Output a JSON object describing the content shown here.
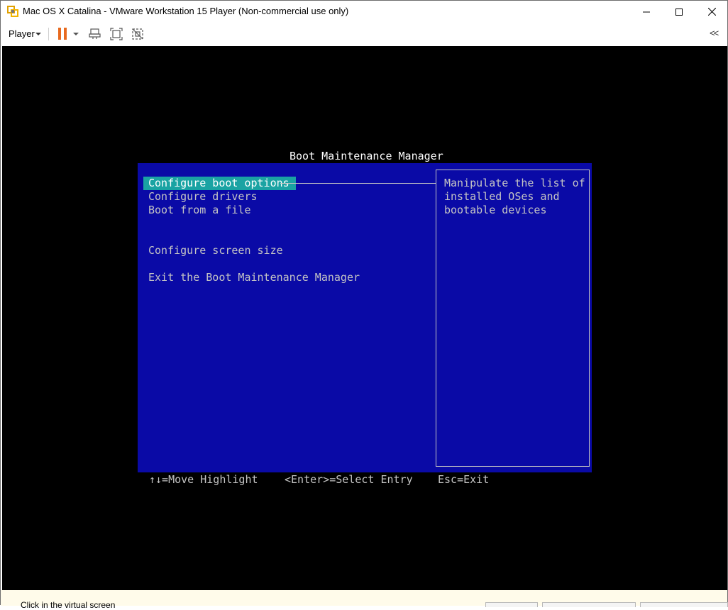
{
  "window": {
    "title": "Mac OS X Catalina - VMware Workstation 15 Player (Non-commercial use only)",
    "minimize_glyph": "—",
    "maximize_glyph": "☐",
    "close_glyph": "✕"
  },
  "toolbar": {
    "player_menu_label": "Player",
    "icons": [
      "pause-icon",
      "send-ctrl-alt-del-icon",
      "fullscreen-icon",
      "unity-icon",
      "collapse-toolbar-icon"
    ],
    "collapse_glyph": "<<",
    "pause_color": "#e86a1f"
  },
  "bios": {
    "title": "Boot Maintenance Manager",
    "menu": [
      {
        "label": "Configure boot options",
        "selected": true
      },
      {
        "label": "Configure drivers",
        "selected": false
      },
      {
        "label": "Boot from a file",
        "selected": false
      },
      {
        "label": "Configure screen size",
        "selected": false
      },
      {
        "label": "Exit the Boot Maintenance Manager",
        "selected": false
      }
    ],
    "help_lines": [
      "Manipulate the list of",
      "installed OSes and",
      "bootable devices"
    ],
    "footer": {
      "move": "↑↓=Move Highlight",
      "select": "<Enter>=Select Entry",
      "exit": "Esc=Exit"
    },
    "colors": {
      "panel": "#0a0aa6",
      "highlight": "#1aa3a3",
      "text": "#c4c4c4",
      "screen": "#000000"
    }
  },
  "statusbar": {
    "hint": "Click in the virtual screen"
  }
}
